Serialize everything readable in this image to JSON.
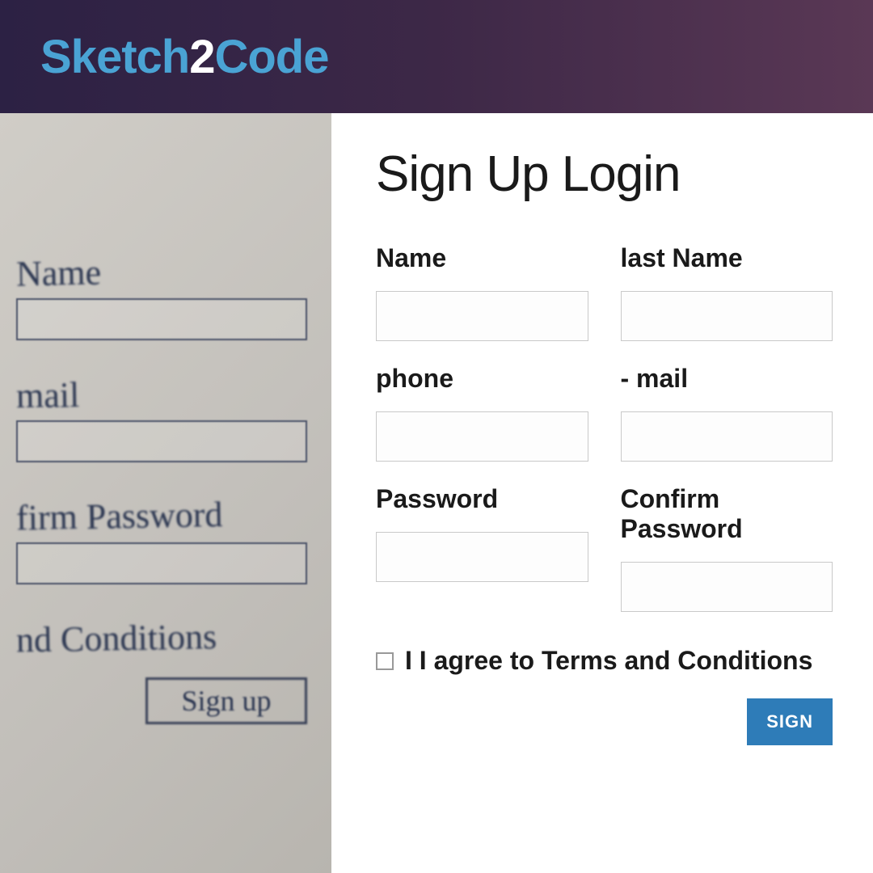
{
  "header": {
    "logo_part1": "Sketch",
    "logo_part2": "2",
    "logo_part3": "Code"
  },
  "sketch": {
    "labels": [
      "Name",
      "mail",
      "firm Password",
      "nd Conditions"
    ],
    "button": "Sign up"
  },
  "form": {
    "title": "Sign Up Login",
    "fields": {
      "name_label": "Name",
      "lastname_label": "last Name",
      "phone_label": "phone",
      "mail_label": "- mail",
      "password_label": "Password",
      "confirm_label": "Confirm Password"
    },
    "terms_label": "I I agree to Terms and Conditions",
    "signup_button": "SIGN"
  },
  "colors": {
    "accent": "#4aa3d4",
    "button": "#2e7cb8",
    "header_gradient_start": "#2c2144",
    "header_gradient_end": "#5a3855"
  }
}
